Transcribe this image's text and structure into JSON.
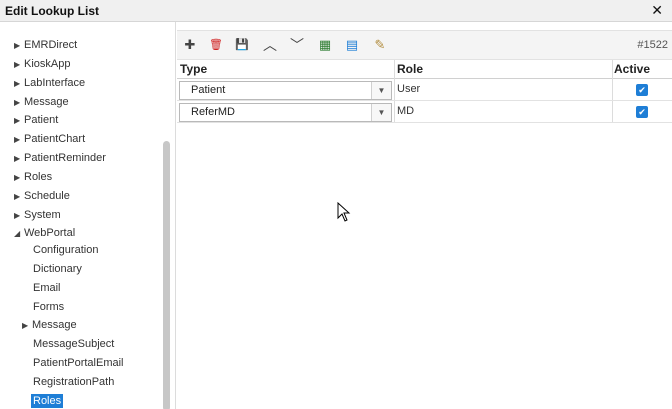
{
  "window": {
    "title": "Edit Lookup List",
    "close_glyph": "✕"
  },
  "sidebar": {
    "items": [
      {
        "label": "EMRDirect",
        "arrow": "right"
      },
      {
        "label": "KioskApp",
        "arrow": "right"
      },
      {
        "label": "LabInterface",
        "arrow": "right"
      },
      {
        "label": "Message",
        "arrow": "right"
      },
      {
        "label": "Patient",
        "arrow": "right"
      },
      {
        "label": "PatientChart",
        "arrow": "right"
      },
      {
        "label": "PatientReminder",
        "arrow": "right"
      },
      {
        "label": "Roles",
        "arrow": "right"
      },
      {
        "label": "Schedule",
        "arrow": "right"
      },
      {
        "label": "System",
        "arrow": "right"
      },
      {
        "label": "WebPortal",
        "arrow": "down"
      }
    ],
    "children": [
      {
        "label": "Configuration"
      },
      {
        "label": "Dictionary"
      },
      {
        "label": "Email"
      },
      {
        "label": "Forms"
      },
      {
        "label": "Message",
        "arrow": "right"
      },
      {
        "label": "MessageSubject"
      },
      {
        "label": "PatientPortalEmail"
      },
      {
        "label": "RegistrationPath"
      },
      {
        "label": "Roles",
        "selected": true
      }
    ]
  },
  "toolbar": {
    "buttons": [
      {
        "name": "add-icon",
        "glyph": "✚",
        "color": "#444444"
      },
      {
        "name": "delete-icon",
        "glyph": "🗑",
        "color": "#d02020"
      },
      {
        "name": "save-icon",
        "glyph": "💾",
        "color": "#555555"
      },
      {
        "name": "move-up-icon",
        "glyph": "⌃",
        "color": "#444444"
      },
      {
        "name": "move-down-icon",
        "glyph": "⌄",
        "color": "#444444"
      },
      {
        "name": "excel-export-icon",
        "glyph": "▦",
        "color": "#2e7d32"
      },
      {
        "name": "import-icon",
        "glyph": "▤",
        "color": "#1e7ed6"
      },
      {
        "name": "notes-icon",
        "glyph": "✎",
        "color": "#b08a3a"
      }
    ],
    "record_count": "#1522"
  },
  "grid": {
    "columns": [
      "Type",
      "Role",
      "Active"
    ],
    "rows": [
      {
        "type": "Patient",
        "role": "User",
        "active": true
      },
      {
        "type": "ReferMD",
        "role": "MD",
        "active": true
      }
    ]
  },
  "colors": {
    "accent": "#1e7ed6",
    "delete": "#d02020"
  }
}
